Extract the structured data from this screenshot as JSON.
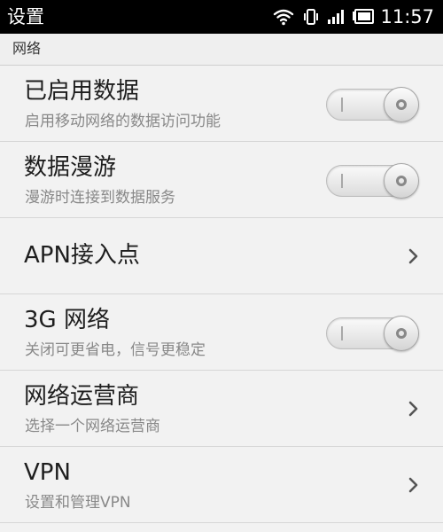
{
  "status_bar": {
    "title": "设置",
    "time": "11:57",
    "icons": [
      "wifi-icon",
      "vibrate-icon",
      "signal-icon",
      "battery-icon"
    ]
  },
  "section": {
    "header": "网络"
  },
  "rows": [
    {
      "title": "已启用数据",
      "subtitle": "启用移动网络的数据访问功能",
      "control": "toggle",
      "state": "off"
    },
    {
      "title": "数据漫游",
      "subtitle": "漫游时连接到数据服务",
      "control": "toggle",
      "state": "off"
    },
    {
      "title": "APN接入点",
      "subtitle": "",
      "control": "chevron"
    },
    {
      "title": "3G 网络",
      "subtitle": "关闭可更省电，信号更稳定",
      "control": "toggle",
      "state": "off"
    },
    {
      "title": "网络运营商",
      "subtitle": "选择一个网络运营商",
      "control": "chevron"
    },
    {
      "title": "VPN",
      "subtitle": "设置和管理VPN",
      "control": "chevron"
    }
  ],
  "colors": {
    "status_bar_bg": "#000000",
    "page_bg": "#f2f2f2",
    "title_text": "#1e1e1e",
    "subtitle_text": "#888888",
    "divider": "#d6d6d6"
  }
}
